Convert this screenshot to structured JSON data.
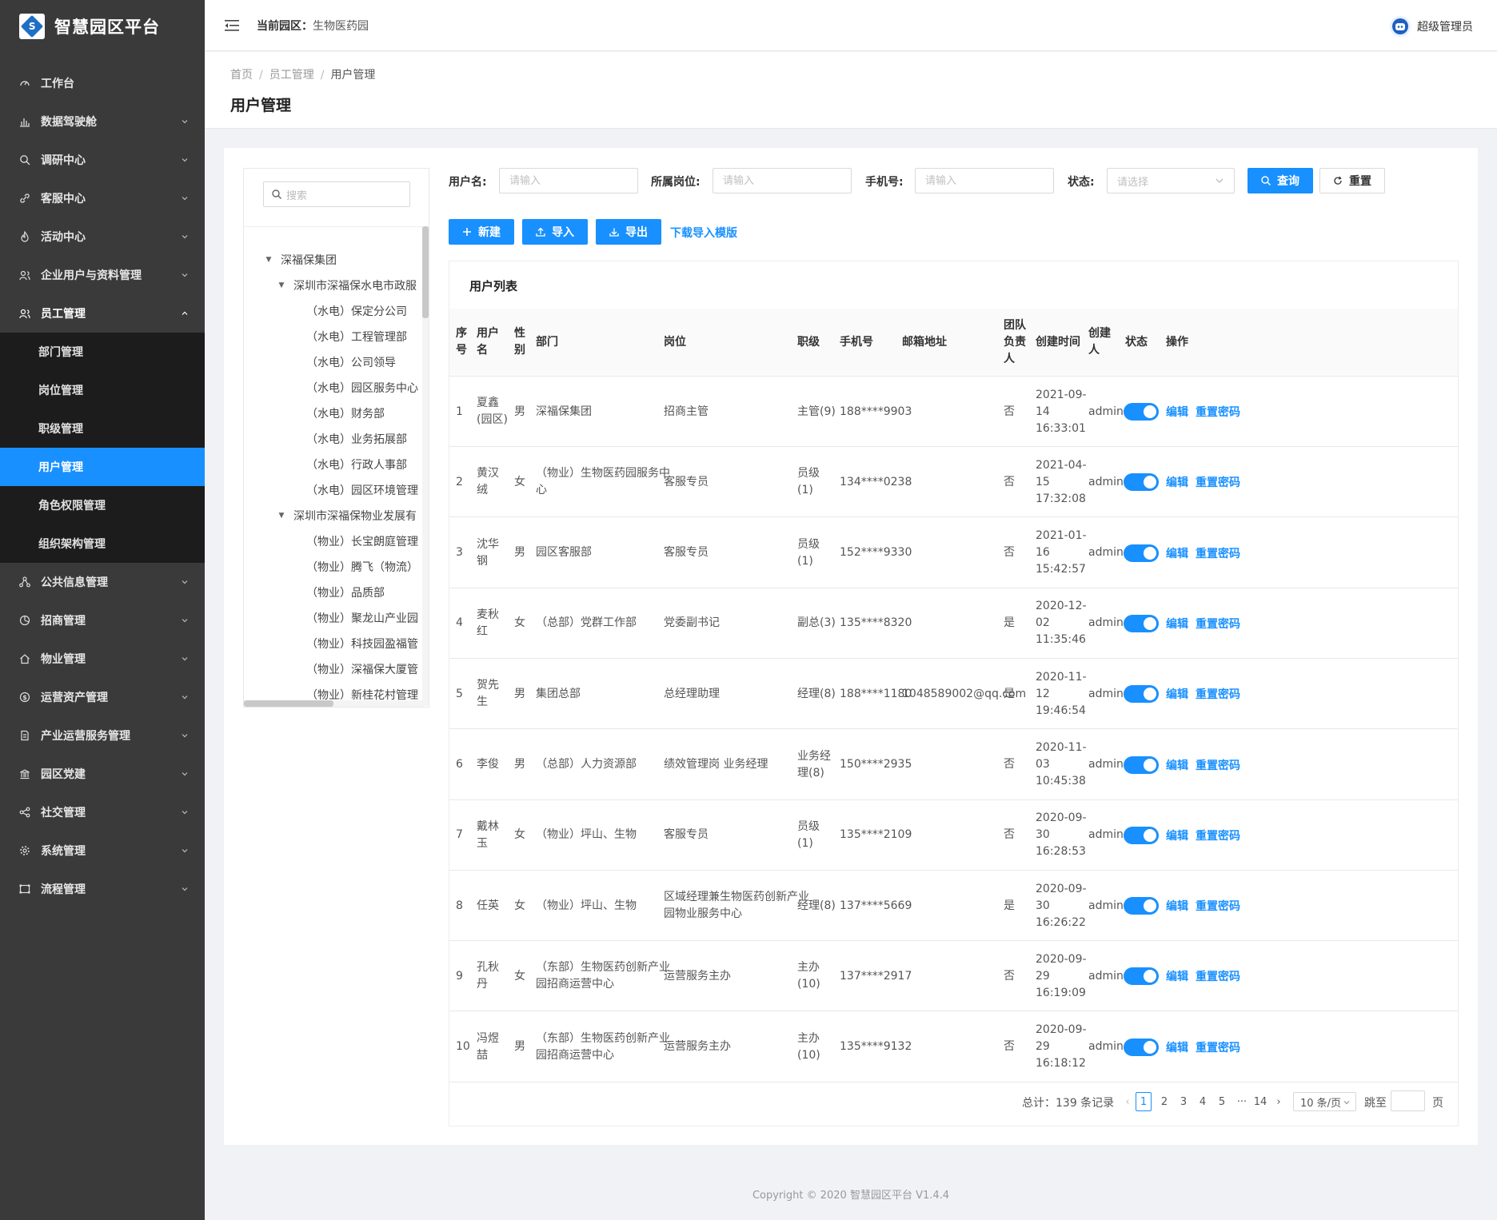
{
  "app": {
    "title": "智慧园区平台",
    "logo_letter": "S"
  },
  "header": {
    "park_label": "当前园区：",
    "park_value": "生物医药园",
    "user": "超级管理员"
  },
  "colors": {
    "accent": "#1890ff",
    "sidebar_bg": "#3a3a3a",
    "submenu_bg": "#1c1c1c"
  },
  "sidebar": {
    "items": [
      {
        "label": "工作台",
        "icon": "dashboard-icon",
        "arrow": false
      },
      {
        "label": "数据驾驶舱",
        "icon": "bar-chart-icon",
        "arrow": true
      },
      {
        "label": "调研中心",
        "icon": "search-icon",
        "arrow": true
      },
      {
        "label": "客服中心",
        "icon": "link-icon",
        "arrow": true
      },
      {
        "label": "活动中心",
        "icon": "fire-icon",
        "arrow": true
      },
      {
        "label": "企业用户与资料管理",
        "icon": "team-icon",
        "arrow": true
      },
      {
        "label": "员工管理",
        "icon": "user-group-icon",
        "arrow": true,
        "open": true,
        "children": [
          "部门管理",
          "岗位管理",
          "职级管理",
          "用户管理",
          "角色权限管理",
          "组织架构管理"
        ],
        "active_child": 3
      },
      {
        "label": "公共信息管理",
        "icon": "cluster-icon",
        "arrow": true
      },
      {
        "label": "招商管理",
        "icon": "pie-chart-icon",
        "arrow": true
      },
      {
        "label": "物业管理",
        "icon": "home-icon",
        "arrow": true
      },
      {
        "label": "运营资产管理",
        "icon": "dollar-icon",
        "arrow": true
      },
      {
        "label": "产业运营服务管理",
        "icon": "file-icon",
        "arrow": true
      },
      {
        "label": "园区党建",
        "icon": "bank-icon",
        "arrow": true
      },
      {
        "label": "社交管理",
        "icon": "share-icon",
        "arrow": true
      },
      {
        "label": "系统管理",
        "icon": "gear-icon",
        "arrow": true
      },
      {
        "label": "流程管理",
        "icon": "flow-icon",
        "arrow": true
      }
    ]
  },
  "breadcrumb": [
    "首页",
    "员工管理",
    "用户管理"
  ],
  "page_title": "用户管理",
  "tree": {
    "search_placeholder": "搜索",
    "nodes": [
      {
        "label": "深福保集团",
        "level": 0,
        "expand": true
      },
      {
        "label": "深圳市深福保水电市政服",
        "level": 1,
        "expand": true
      },
      {
        "label": "（水电）保定分公司",
        "level": 2
      },
      {
        "label": "（水电）工程管理部",
        "level": 2
      },
      {
        "label": "（水电）公司领导",
        "level": 2
      },
      {
        "label": "（水电）园区服务中心",
        "level": 2
      },
      {
        "label": "（水电）财务部",
        "level": 2
      },
      {
        "label": "（水电）业务拓展部",
        "level": 2
      },
      {
        "label": "（水电）行政人事部",
        "level": 2
      },
      {
        "label": "（水电）园区环境管理",
        "level": 2
      },
      {
        "label": "深圳市深福保物业发展有",
        "level": 1,
        "expand": true
      },
      {
        "label": "（物业）长宝朗庭管理",
        "level": 2
      },
      {
        "label": "（物业）腾飞（物流）",
        "level": 2
      },
      {
        "label": "（物业）品质部",
        "level": 2
      },
      {
        "label": "（物业）聚龙山产业园",
        "level": 2
      },
      {
        "label": "（物业）科技园盈福管",
        "level": 2
      },
      {
        "label": "（物业）深福保大厦管",
        "level": 2
      },
      {
        "label": "（物业）新桂花村管理",
        "level": 2
      }
    ]
  },
  "filters": {
    "username_label": "用户名:",
    "username_placeholder": "请输入",
    "post_label": "所属岗位:",
    "post_placeholder": "请输入",
    "phone_label": "手机号:",
    "phone_placeholder": "请输入",
    "status_label": "状态:",
    "status_placeholder": "请选择",
    "query_label": "查询",
    "reset_label": "重置"
  },
  "actions": {
    "new_label": "新建",
    "import_label": "导入",
    "export_label": "导出",
    "template_label": "下载导入模版"
  },
  "table": {
    "title": "用户列表",
    "headers": {
      "seq": [
        "序",
        "号"
      ],
      "name": [
        "用户",
        "名"
      ],
      "gender": [
        "性",
        "别"
      ],
      "dept": "部门",
      "post": "岗位",
      "rank": "职级",
      "phone": "手机号",
      "email": "邮箱地址",
      "leader": [
        "团队",
        "负责",
        "人"
      ],
      "created": "创建时间",
      "creator": [
        "创建",
        "人"
      ],
      "status": "状态",
      "ops": "操作"
    },
    "edit_label": "编辑",
    "resetpwd_label": "重置密码",
    "rows": [
      {
        "seq": "1",
        "name": [
          "夏鑫",
          "(园区)"
        ],
        "gender": "男",
        "dept": [
          "深福保集团"
        ],
        "post": [
          "招商主管"
        ],
        "rank": [
          "主管(9)"
        ],
        "phone": "188****9903",
        "email": "",
        "leader": "否",
        "created": [
          "2021-09-",
          "14",
          "16:33:01"
        ],
        "creator": "admin",
        "enabled": true
      },
      {
        "seq": "2",
        "name": [
          "黄汉",
          "绒"
        ],
        "gender": "女",
        "dept": [
          "（物业）生物医药园服务中",
          "心"
        ],
        "post": [
          "客服专员"
        ],
        "rank": [
          "员级",
          "(1)"
        ],
        "phone": "134****0238",
        "email": "",
        "leader": "否",
        "created": [
          "2021-04-",
          "15",
          "17:32:08"
        ],
        "creator": "admin",
        "enabled": true
      },
      {
        "seq": "3",
        "name": [
          "沈华",
          "钢"
        ],
        "gender": "男",
        "dept": [
          "园区客服部"
        ],
        "post": [
          "客服专员"
        ],
        "rank": [
          "员级",
          "(1)"
        ],
        "phone": "152****9330",
        "email": "",
        "leader": "否",
        "created": [
          "2021-01-",
          "16",
          "15:42:57"
        ],
        "creator": "admin",
        "enabled": true
      },
      {
        "seq": "4",
        "name": [
          "麦秋",
          "红"
        ],
        "gender": "女",
        "dept": [
          "（总部）党群工作部"
        ],
        "post": [
          "党委副书记"
        ],
        "rank": [
          "副总(3)"
        ],
        "phone": "135****8320",
        "email": "",
        "leader": "是",
        "created": [
          "2020-12-",
          "02",
          "11:35:46"
        ],
        "creator": "admin",
        "enabled": true
      },
      {
        "seq": "5",
        "name": [
          "贺先",
          "生"
        ],
        "gender": "男",
        "dept": [
          "集团总部"
        ],
        "post": [
          "总经理助理"
        ],
        "rank": [
          "经理(8)"
        ],
        "phone": "188****1180",
        "email": "1048589002@qq.com",
        "leader": "是",
        "created": [
          "2020-11-",
          "12",
          "19:46:54"
        ],
        "creator": "admin",
        "enabled": true
      },
      {
        "seq": "6",
        "name": [
          "李俊"
        ],
        "gender": "男",
        "dept": [
          "（总部）人力资源部"
        ],
        "post": [
          "绩效管理岗 业务经理"
        ],
        "rank": [
          "业务经",
          "理(8)"
        ],
        "phone": "150****2935",
        "email": "",
        "leader": "否",
        "created": [
          "2020-11-",
          "03",
          "10:45:38"
        ],
        "creator": "admin",
        "enabled": true
      },
      {
        "seq": "7",
        "name": [
          "戴林",
          "玉"
        ],
        "gender": "女",
        "dept": [
          "（物业）坪山、生物"
        ],
        "post": [
          "客服专员"
        ],
        "rank": [
          "员级",
          "(1)"
        ],
        "phone": "135****2109",
        "email": "",
        "leader": "否",
        "created": [
          "2020-09-",
          "30",
          "16:28:53"
        ],
        "creator": "admin",
        "enabled": true
      },
      {
        "seq": "8",
        "name": [
          "任英"
        ],
        "gender": "女",
        "dept": [
          "（物业）坪山、生物"
        ],
        "post": [
          "区域经理兼生物医药创新产业",
          "园物业服务中心"
        ],
        "rank": [
          "经理(8)"
        ],
        "phone": "137****5669",
        "email": "",
        "leader": "是",
        "created": [
          "2020-09-",
          "30",
          "16:26:22"
        ],
        "creator": "admin",
        "enabled": true
      },
      {
        "seq": "9",
        "name": [
          "孔秋",
          "丹"
        ],
        "gender": "女",
        "dept": [
          "（东部）生物医药创新产业",
          "园招商运营中心"
        ],
        "post": [
          "运营服务主办"
        ],
        "rank": [
          "主办",
          "(10)"
        ],
        "phone": "137****2917",
        "email": "",
        "leader": "否",
        "created": [
          "2020-09-",
          "29",
          "16:19:09"
        ],
        "creator": "admin",
        "enabled": true
      },
      {
        "seq": "10",
        "name": [
          "冯煜",
          "喆"
        ],
        "gender": "男",
        "dept": [
          "（东部）生物医药创新产业",
          "园招商运营中心"
        ],
        "post": [
          "运营服务主办"
        ],
        "rank": [
          "主办",
          "(10)"
        ],
        "phone": "135****9132",
        "email": "",
        "leader": "否",
        "created": [
          "2020-09-",
          "29",
          "16:18:12"
        ],
        "creator": "admin",
        "enabled": true
      }
    ]
  },
  "pagination": {
    "total_text": "总计：139 条记录",
    "prev": "‹",
    "next": "›",
    "pages": [
      "1",
      "2",
      "3",
      "4",
      "5",
      "···",
      "14"
    ],
    "current": "1",
    "page_size": "10 条/页",
    "jump_label": "跳至",
    "page_unit": "页"
  },
  "footer": "Copyright © 2020 智慧园区平台 V1.4.4"
}
